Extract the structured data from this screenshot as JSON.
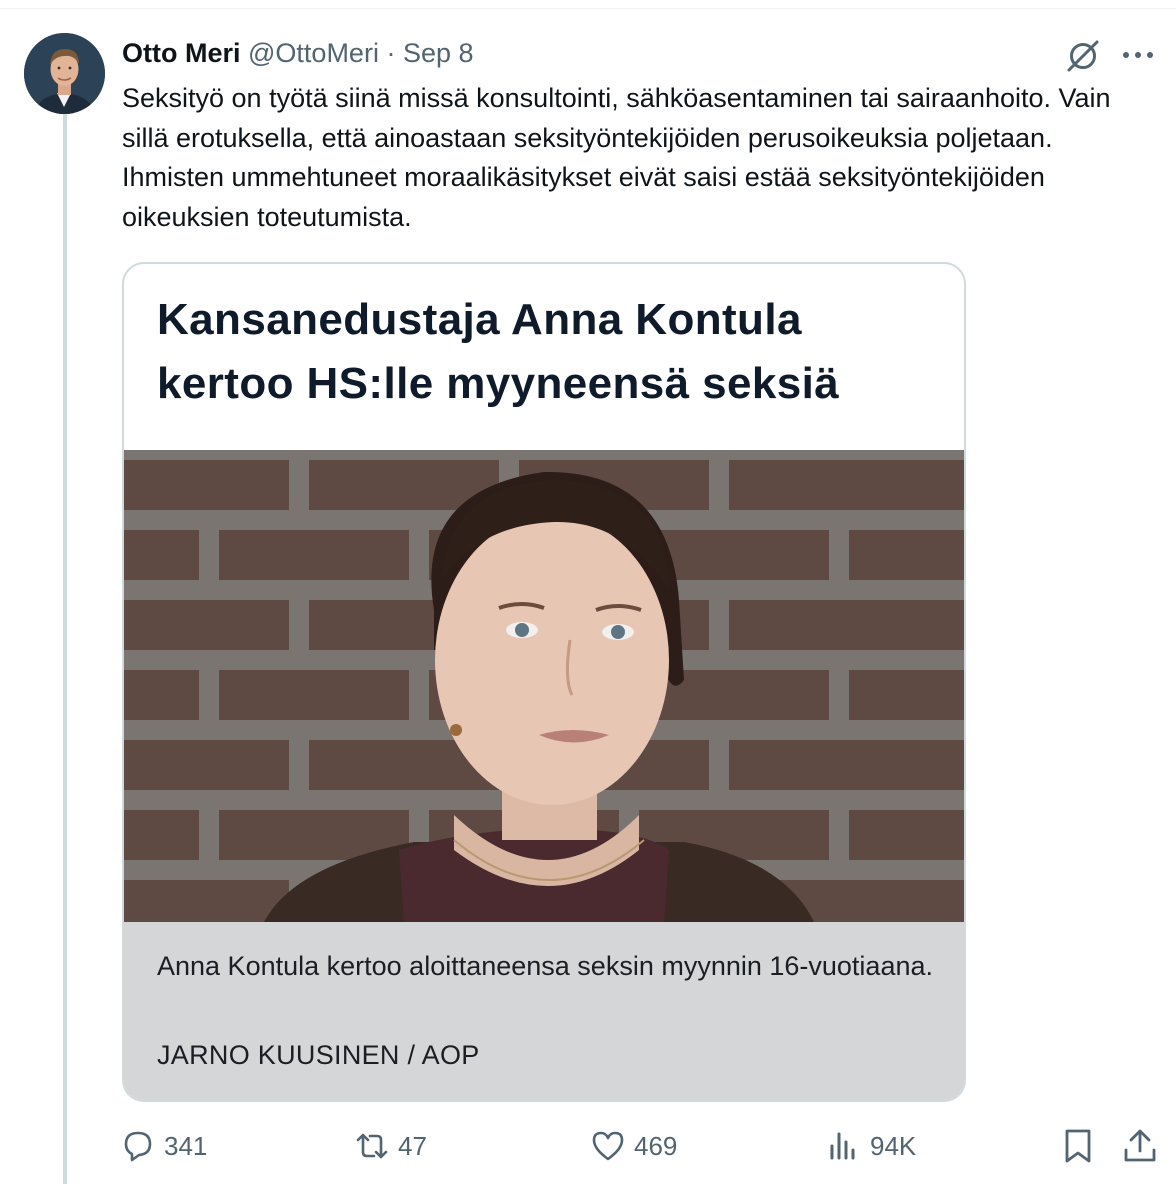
{
  "tweet": {
    "author": {
      "display_name": "Otto Meri",
      "handle": "@OttoMeri",
      "separator": "·",
      "date": "Sep 8"
    },
    "text": "Seksityö on työtä siinä missä konsultointi, sähköasentaminen tai sairaanhoito. Vain sillä erotuksella, että ainoastaan seksityöntekijöiden perusoikeuksia poljetaan. Ihmisten ummehtuneet moraalikäsitykset eivät saisi estää seksityöntekijöiden oikeuksien toteutumista."
  },
  "card": {
    "headline_line1": "Kansanedustaja Anna Kontula",
    "headline_line2": "kertoo HS:lle myyneensä seksiä",
    "caption": "Anna Kontula kertoo aloittaneensa seksin myynnin 16-vuotiaana.",
    "credit": "JARNO KUUSINEN / AOP"
  },
  "actions": {
    "replies": "341",
    "reposts": "47",
    "likes": "469",
    "views": "94K"
  },
  "icons": {
    "reply": "reply-icon",
    "repost": "repost-icon",
    "like": "heart-icon",
    "views": "views-icon",
    "bookmark": "bookmark-icon",
    "share": "share-icon",
    "grok": "grok-icon",
    "more": "more-icon"
  },
  "colors": {
    "text": "#0f1419",
    "secondary": "#536471",
    "border": "#cfd9de",
    "caption_bg": "#d4d6d8"
  }
}
